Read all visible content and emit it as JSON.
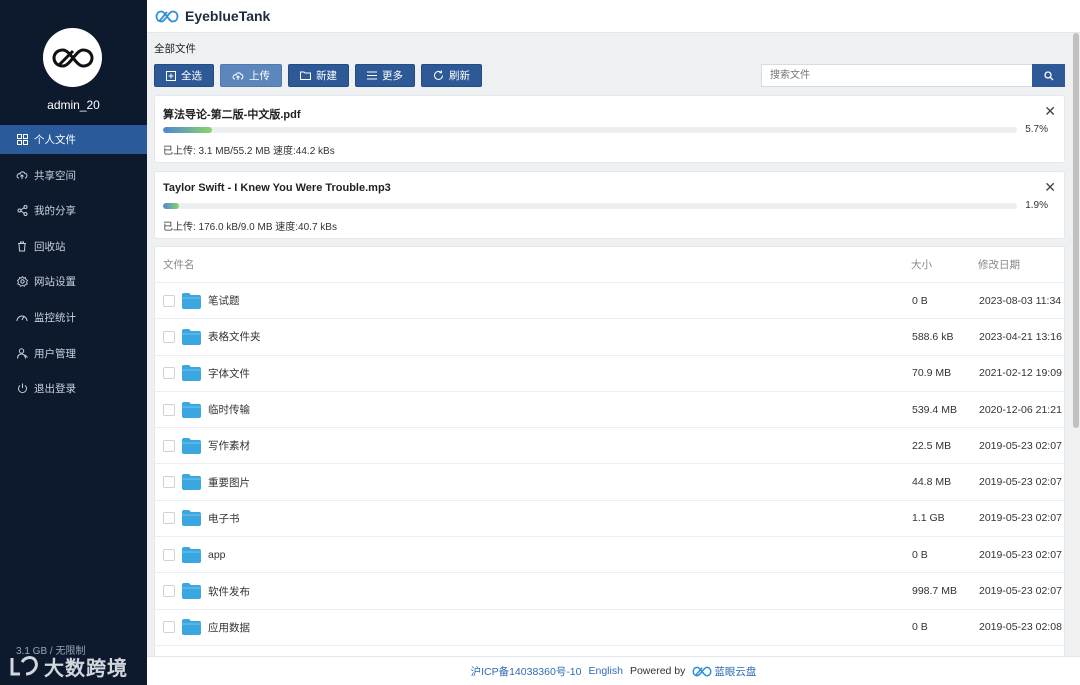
{
  "app": {
    "brand": "EyeblueTank"
  },
  "sidebar": {
    "username": "admin_20",
    "items": [
      {
        "label": "个人文件",
        "icon": "grid-icon",
        "active": true
      },
      {
        "label": "共享空间",
        "icon": "cloud-icon"
      },
      {
        "label": "我的分享",
        "icon": "share-icon"
      },
      {
        "label": "回收站",
        "icon": "trash-icon"
      },
      {
        "label": "网站设置",
        "icon": "gear-icon"
      },
      {
        "label": "监控统计",
        "icon": "dashboard-icon"
      },
      {
        "label": "用户管理",
        "icon": "user-icon"
      },
      {
        "label": "退出登录",
        "icon": "power-icon"
      }
    ],
    "storage": "3.1 GB / 无限制",
    "watermark": "大数跨境"
  },
  "breadcrumb": "全部文件",
  "toolbar": {
    "select_all": "全选",
    "upload": "上传",
    "new": "新建",
    "more": "更多",
    "refresh": "刷新"
  },
  "search": {
    "placeholder": "搜索文件"
  },
  "uploads": [
    {
      "name": "算法导论-第二版-中文版.pdf",
      "progress": 0.057,
      "percent": "5.7%",
      "info": "已上传: 3.1 MB/55.2 MB 速度:44.2 kBs"
    },
    {
      "name": "Taylor Swift - I Knew You Were Trouble.mp3",
      "progress": 0.019,
      "percent": "1.9%",
      "info": "已上传: 176.0 kB/9.0 MB 速度:40.7 kBs"
    }
  ],
  "table": {
    "headers": {
      "name": "文件名",
      "size": "大小",
      "date": "修改日期"
    },
    "rows": [
      {
        "name": "笔试题",
        "size": "0 B",
        "date": "2023-08-03 11:34"
      },
      {
        "name": "表格文件夹",
        "size": "588.6 kB",
        "date": "2023-04-21 13:16"
      },
      {
        "name": "字体文件",
        "size": "70.9 MB",
        "date": "2021-02-12 19:09"
      },
      {
        "name": "临时传输",
        "size": "539.4 MB",
        "date": "2020-12-06 21:21"
      },
      {
        "name": "写作素材",
        "size": "22.5 MB",
        "date": "2019-05-23 02:07"
      },
      {
        "name": "重要图片",
        "size": "44.8 MB",
        "date": "2019-05-23 02:07"
      },
      {
        "name": "电子书",
        "size": "1.1 GB",
        "date": "2019-05-23 02:07"
      },
      {
        "name": "app",
        "size": "0 B",
        "date": "2019-05-23 02:07"
      },
      {
        "name": "软件发布",
        "size": "998.7 MB",
        "date": "2019-05-23 02:07"
      },
      {
        "name": "应用数据",
        "size": "0 B",
        "date": "2019-05-23 02:08"
      }
    ]
  },
  "footer": {
    "icp": "沪ICP备14038360号-10",
    "lang": "English",
    "powered": "Powered by",
    "product": "蓝眼云盘"
  },
  "colors": {
    "sidebar": "#0d1a2e",
    "accent": "#2d5a96",
    "folder": "#3aa7e0"
  }
}
